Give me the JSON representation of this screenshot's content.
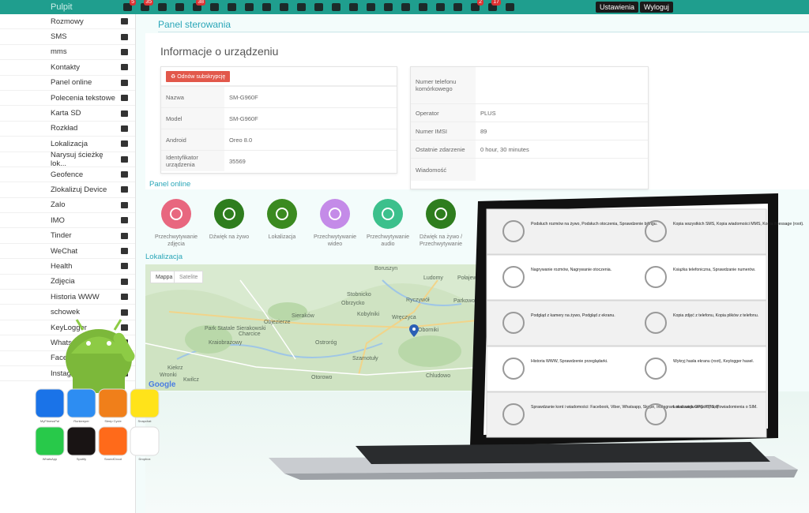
{
  "topbar": {
    "title": "Pulpit",
    "icons": [
      {
        "name": "dashboard-icon",
        "badge": "5"
      },
      {
        "name": "sms-icon",
        "badge": "35"
      },
      {
        "name": "files-icon",
        "badge": ""
      },
      {
        "name": "whatsapp-icon",
        "badge": ""
      },
      {
        "name": "gallery-icon",
        "badge": "38"
      },
      {
        "name": "viber-icon",
        "badge": ""
      },
      {
        "name": "tinder-icon",
        "badge": ""
      },
      {
        "name": "wechat-icon",
        "badge": ""
      },
      {
        "name": "snapchat-icon",
        "badge": ""
      },
      {
        "name": "phone-icon",
        "badge": ""
      },
      {
        "name": "skype-icon",
        "badge": ""
      },
      {
        "name": "zalo-icon",
        "badge": ""
      },
      {
        "name": "call-icon",
        "badge": ""
      },
      {
        "name": "calendar-icon",
        "badge": ""
      },
      {
        "name": "mail-icon",
        "badge": ""
      },
      {
        "name": "note-icon",
        "badge": ""
      },
      {
        "name": "hangouts-icon",
        "badge": ""
      },
      {
        "name": "skype2-icon",
        "badge": ""
      },
      {
        "name": "line-icon",
        "badge": ""
      },
      {
        "name": "instagram-icon",
        "badge": ""
      },
      {
        "name": "checklist-icon",
        "badge": "2"
      },
      {
        "name": "location-icon",
        "badge": "17"
      },
      {
        "name": "download-icon",
        "badge": ""
      }
    ],
    "settings_label": "Ustawienia",
    "logout_label": "Wyloguj"
  },
  "sidebar": {
    "items": [
      {
        "label": "Rozmowy",
        "icon": "phone-icon"
      },
      {
        "label": "SMS",
        "icon": "envelope-icon"
      },
      {
        "label": "mms",
        "icon": "file-icon"
      },
      {
        "label": "Kontakty",
        "icon": "contacts-icon"
      },
      {
        "label": "Panel online",
        "icon": "eye-icon"
      },
      {
        "label": "Polecenia tekstowe",
        "icon": "commands-icon"
      },
      {
        "label": "Karta SD",
        "icon": "folder-icon"
      },
      {
        "label": "Rozkład",
        "icon": "clock-icon"
      },
      {
        "label": "Lokalizacja",
        "icon": "pin-icon"
      },
      {
        "label": "Narysuj ścieżkę lok...",
        "icon": "road-icon"
      },
      {
        "label": "Geofence",
        "icon": "crosshair-icon"
      },
      {
        "label": "Zlokalizuj Device",
        "icon": "wifi-icon"
      },
      {
        "label": "Zalo",
        "icon": "zalo-icon"
      },
      {
        "label": "IMO",
        "icon": "imo-icon"
      },
      {
        "label": "Tinder",
        "icon": "tinder-icon"
      },
      {
        "label": "WeChat",
        "icon": "wechat-icon"
      },
      {
        "label": "Health",
        "icon": "heartbeat-icon"
      },
      {
        "label": "Zdjęcia",
        "icon": "image-icon"
      },
      {
        "label": "Historia WWW",
        "icon": "globe-icon"
      },
      {
        "label": "schowek",
        "icon": "clipboard-icon"
      },
      {
        "label": "KeyLogger",
        "icon": "keyboard-icon"
      },
      {
        "label": "Whatsapp",
        "icon": "whatsapp-icon"
      },
      {
        "label": "Facebook",
        "icon": "facebook-icon"
      },
      {
        "label": "Instagram",
        "icon": "instagram-icon"
      }
    ]
  },
  "main": {
    "panel_title": "Panel sterowania",
    "info_title": "Informacje o urządzeniu",
    "refresh_label": "Odnów subskrypcję",
    "left_table": [
      {
        "key": "Nazwa",
        "value": "SM-G960F"
      },
      {
        "key": "Model",
        "value": "SM-G960F"
      },
      {
        "key": "Android",
        "value": "Oreo 8.0"
      },
      {
        "key": "Identyfikator urządzenia",
        "value": "35569"
      }
    ],
    "right_table": [
      {
        "key": "Numer telefonu komórkowego",
        "value": ""
      },
      {
        "key": "Operator",
        "value": "PLUS"
      },
      {
        "key": "Numer IMSI",
        "value": "89"
      },
      {
        "key": "Ostatnie zdarzenie",
        "value": "0 hour, 30 minutes"
      },
      {
        "key": "Wiadomość",
        "value": ""
      }
    ],
    "panel_online_title": "Panel online",
    "panel_online": [
      {
        "label": "Przechwytywanie zdjęcia",
        "color": "#e8677f",
        "icon": "camera-icon"
      },
      {
        "label": "Dźwięk na żywo",
        "color": "#2e7d1e",
        "icon": "speaker-icon"
      },
      {
        "label": "Lokalizacja",
        "color": "#3b8a20",
        "icon": "map-pin-icon"
      },
      {
        "label": "Przechwytywanie wideo",
        "color": "#c48be8",
        "icon": "video-icon"
      },
      {
        "label": "Przechwytywanie audio",
        "color": "#3cc08c",
        "icon": "mic-icon"
      },
      {
        "label": "Dźwięk na żywo / Przechwytywanie",
        "color": "#2e7d1e",
        "icon": "live-video-icon"
      }
    ],
    "location_title": "Lokalizacja",
    "map": {
      "map_tab": "Mappa",
      "satellite_tab": "Satelite",
      "places": [
        "Boruszyn",
        "Ludomy",
        "Połajewo",
        "Stobnicko",
        "Obrzycko",
        "Ryczywół",
        "Parkowo",
        "Wręczyca",
        "Kobylniki",
        "Objezierze",
        "Sieraków",
        "Park Statale Sierakowski",
        "Kraiobrazowy",
        "Charcice",
        "Ostroróg",
        "Szamotuły",
        "Oborniki",
        "Kiekrz",
        "Chludowo",
        "Wronki",
        "Otorowo",
        "Kwilcz"
      ],
      "google": "Google"
    }
  },
  "overlay": {
    "apps": [
      {
        "label": "MyFitnessPal",
        "color": "#1a73e8"
      },
      {
        "label": "Runkeeper",
        "color": "#2d8df2"
      },
      {
        "label": "Sleep Cycle",
        "color": "#f07f1a"
      },
      {
        "label": "Snapchat",
        "color": "#ffe31a"
      },
      {
        "label": "WhatsApp",
        "color": "#28c94a"
      },
      {
        "label": "Spotify",
        "color": "#191414"
      },
      {
        "label": "SoundCloud",
        "color": "#ff6a1a"
      },
      {
        "label": "Dropbox",
        "color": "#ffffff"
      }
    ],
    "laptop_features": [
      {
        "text": "Podsłuch rozmów na żywo, Podsłuch otoczenia, Sprawdzenie bilingu.",
        "icon": "phone-icon"
      },
      {
        "text": "Kopia wszystkich SMS, Kopia wiadomości MMS, Kopia iMessage (root).",
        "icon": "sms-icon"
      },
      {
        "text": "Nagrywanie rozmów, Nagrywanie otoczenia.",
        "icon": "mic-icon"
      },
      {
        "text": "Książka telefoniczna, Sprawdzanie numerów.",
        "icon": "contacts-icon"
      },
      {
        "text": "Podgląd z kamery na żywo, Podgląd z ekranu.",
        "icon": "camera-icon"
      },
      {
        "text": "Kopia zdjęć z telefonu, Kopia plików z telefonu.",
        "icon": "image-icon"
      },
      {
        "text": "Historia WWW, Sprawdzenie przeglądarki.",
        "icon": "www-icon"
      },
      {
        "text": "Wykryj hasła ekranu (root), Keylogger haseł.",
        "icon": "password-icon"
      },
      {
        "text": "Sprawdzanie kont i wiadomości: Facebook, Viber, Whatsapp, Skype, Instagram oraz wielu innych (root).",
        "icon": "facebook-icon"
      },
      {
        "text": "Lokalizacja GPS i BTS, Powiadomienia o SIM.",
        "icon": "location-icon"
      }
    ]
  }
}
